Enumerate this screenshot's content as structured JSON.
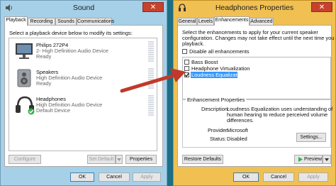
{
  "sound": {
    "title": "Sound",
    "close": "✕",
    "tabs": [
      "Playback",
      "Recording",
      "Sounds",
      "Communications"
    ],
    "instruction": "Select a playback device below to modify its settings:",
    "devices": [
      {
        "name": "Philips 272P4",
        "desc": "2- High Definition Audio Device",
        "status": "Ready"
      },
      {
        "name": "Speakers",
        "desc": "High Definition Audio Device",
        "status": "Ready"
      },
      {
        "name": "Headphones",
        "desc": "High Definition Audio Device",
        "status": "Default Device"
      }
    ],
    "configure": "Configure",
    "set_default": "Set Default",
    "properties": "Properties",
    "ok": "OK",
    "cancel": "Cancel",
    "apply": "Apply"
  },
  "props": {
    "title": "Headphones Properties",
    "close": "✕",
    "tabs": [
      "General",
      "Levels",
      "Enhancements",
      "Advanced"
    ],
    "intro1": "Select the enhancements to apply for your current speaker",
    "intro2": "configuration. Changes may not take effect until the next time you start",
    "intro3": "playback.",
    "disable_all": "Disable all enhancements",
    "enhancements": [
      "Bass Boost",
      "Headphone Virtualization",
      "Loudness Equalization"
    ],
    "group_title": "Enhancement Properties",
    "desc_label": "Description:",
    "desc_lines": [
      "Loudness Equalization uses understanding of",
      "human hearing to reduce perceived volume",
      "differences."
    ],
    "provider_label": "Provider:",
    "provider_value": "Microsoft",
    "status_label": "Status:",
    "status_value": "Disabled",
    "settings": "Settings...",
    "restore": "Restore Defaults",
    "preview": "Preview",
    "ok": "OK",
    "cancel": "Cancel",
    "apply": "Apply"
  },
  "colors": {
    "arrow": "#c0392b",
    "selection": "#3399ff",
    "check": "#2db24a"
  }
}
